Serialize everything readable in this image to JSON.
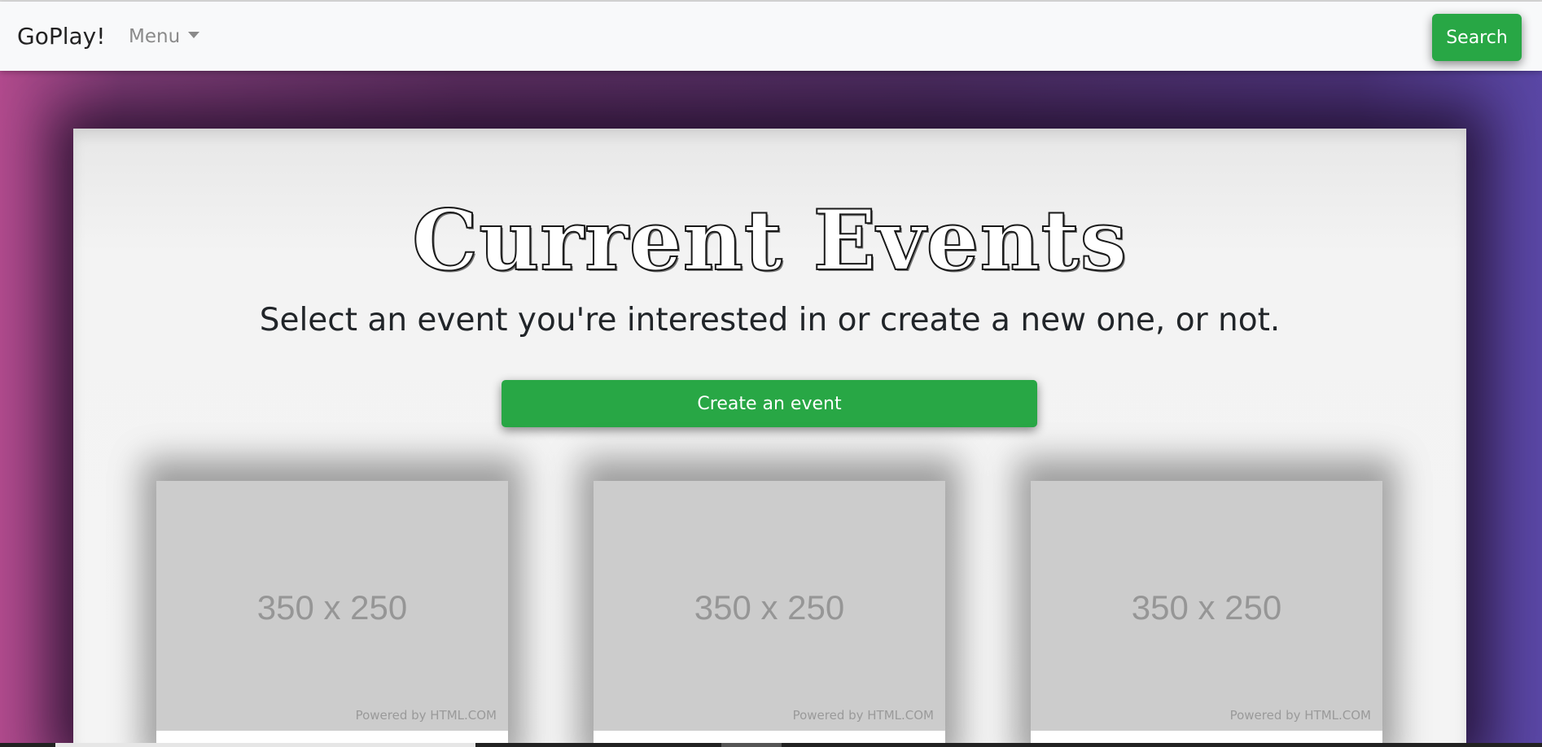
{
  "navbar": {
    "brand": "GoPlay!",
    "menu_label": "Menu",
    "search_label": "Search"
  },
  "main": {
    "title": "Current Events",
    "subtitle": "Select an event you're interested in or create a new one, or not.",
    "create_button": "Create an event"
  },
  "cards": [
    {
      "placeholder": "350 x 250",
      "powered": "Powered by HTML.COM"
    },
    {
      "placeholder": "350 x 250",
      "powered": "Powered by HTML.COM"
    },
    {
      "placeholder": "350 x 250",
      "powered": "Powered by HTML.COM"
    }
  ],
  "colors": {
    "accent": "#28a745",
    "navbar_bg": "#f8f9fa",
    "panel_bg": "#f4f4f4",
    "placeholder_bg": "#cccccc"
  }
}
